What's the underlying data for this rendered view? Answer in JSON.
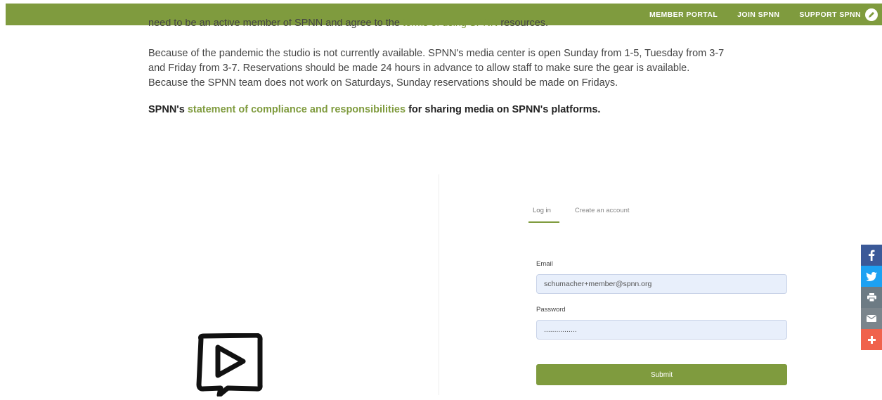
{
  "nav": {
    "items": [
      "MEMBER PORTAL",
      "JOIN SPNN",
      "SUPPORT SPNN"
    ],
    "edit_icon": "edit-icon"
  },
  "intro": {
    "clipped_before": "need to be an active member of SPNN and agree to the ",
    "clipped_link": "terms of using SPNN",
    "clipped_after": " resources."
  },
  "paragraph": "Because of the pandemic the studio is not currently available. SPNN's media center is open Sunday from 1-5, Tuesday from 3-7 and Friday from 3-7. Reservations should be made 24 hours in advance to allow staff to make sure the gear is available. Because the SPNN team does not work on Saturdays, Sunday reservations should be made on Fridays.",
  "compliance": {
    "before": "SPNN's ",
    "link": "statement of compliance and responsibilities",
    "after": " for sharing media on SPNN's platforms."
  },
  "login": {
    "tabs": [
      "Log in",
      "Create an account"
    ],
    "email_label": "Email",
    "email_value": "schumacher+member@spnn.org",
    "password_label": "Password",
    "password_value": "................",
    "submit_label": "Submit"
  },
  "social": [
    {
      "icon": "facebook-icon",
      "color": "#3b5998",
      "glyph": "f"
    },
    {
      "icon": "twitter-icon",
      "color": "#1da1f2",
      "glyph": "t"
    },
    {
      "icon": "print-icon",
      "color": "#6d7b84",
      "glyph": "p"
    },
    {
      "icon": "email-icon",
      "color": "#7b858c",
      "glyph": "e"
    },
    {
      "icon": "share-plus-icon",
      "color": "#f0624c",
      "glyph": "+"
    }
  ],
  "colors": {
    "accent": "#7f9b3e"
  }
}
